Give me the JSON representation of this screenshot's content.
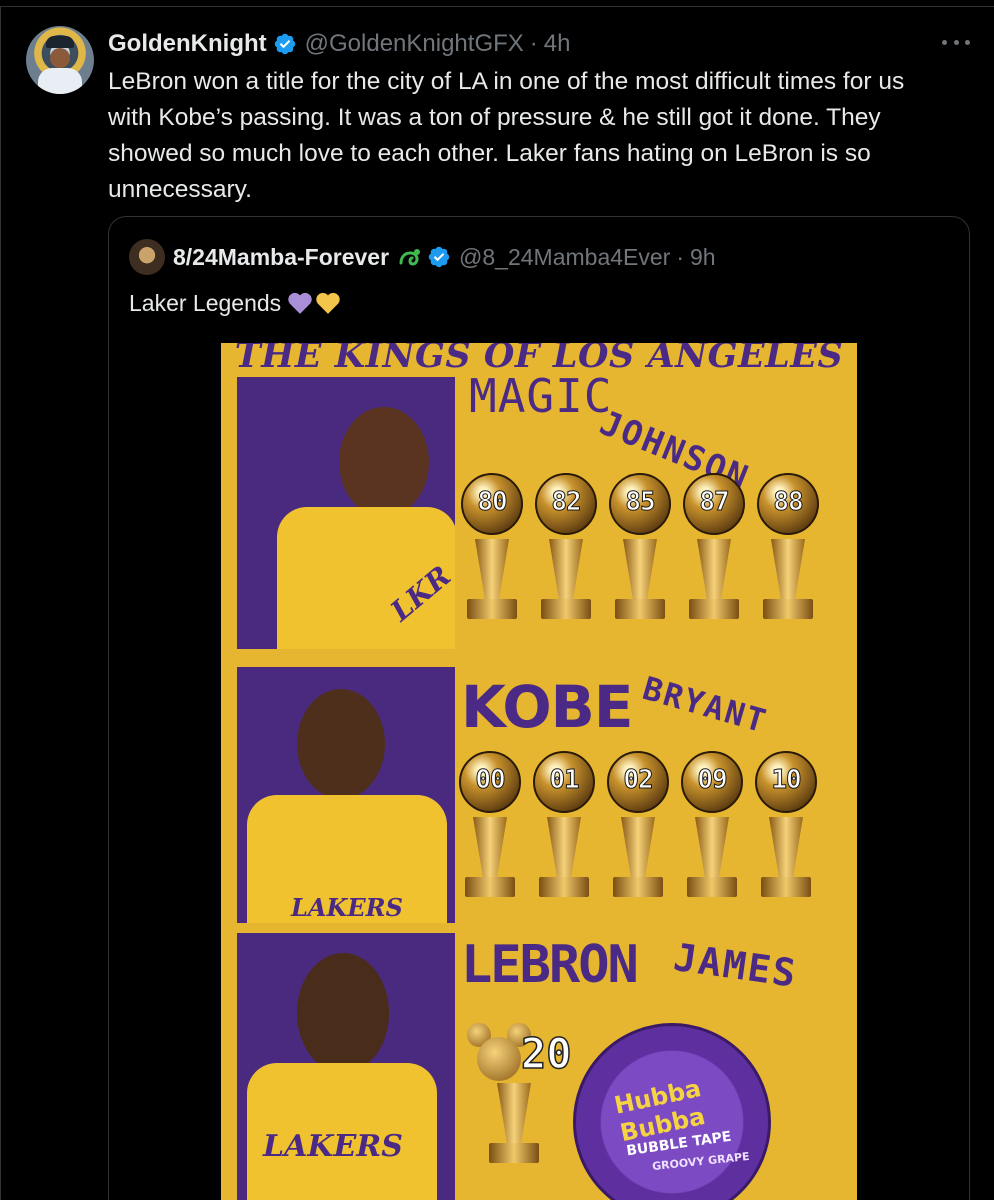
{
  "tweet": {
    "author_name": "GoldenKnight",
    "author_handle": "@GoldenKnightGFX",
    "separator": "·",
    "time": "4h",
    "text": "LeBron won a title for the city of LA in one of the most difficult times for us\nwith Kobe’s passing. It was a ton of pressure & he still got it done. They\nshowed so much love to each other. Laker fans hating on LeBron is so\nunnecessary."
  },
  "quoted_tweet": {
    "author_name": "8/24Mamba-Forever",
    "author_handle": "@8_24Mamba4Ever",
    "separator": "·",
    "time": "9h",
    "text": "Laker Legends"
  },
  "media": {
    "title": "THE KINGS OF LOS ANGELES",
    "players": [
      {
        "first": "MAGIC",
        "last": "JOHNSON",
        "jersey_text": "LKR",
        "years": [
          "80",
          "82",
          "85",
          "87",
          "88"
        ]
      },
      {
        "first": "KOBE",
        "last": "BRYANT",
        "jersey_text": "LAKERS",
        "years": [
          "00",
          "01",
          "02",
          "09",
          "10"
        ]
      },
      {
        "first": "LEBRON",
        "last": "JAMES",
        "jersey_text": "LAKERS",
        "years": [
          "20"
        ]
      }
    ],
    "gum_brand": "Hubba Bubba",
    "gum_sub": "BUBBLE TAPE",
    "gum_flavor": "GROOVY GRAPE"
  },
  "colors": {
    "background": "#000000",
    "text": "#e7e9ea",
    "muted": "#71767b",
    "verified": "#1d9bf0",
    "lakers_gold": "#e7b631",
    "lakers_purple": "#4b2a86"
  }
}
